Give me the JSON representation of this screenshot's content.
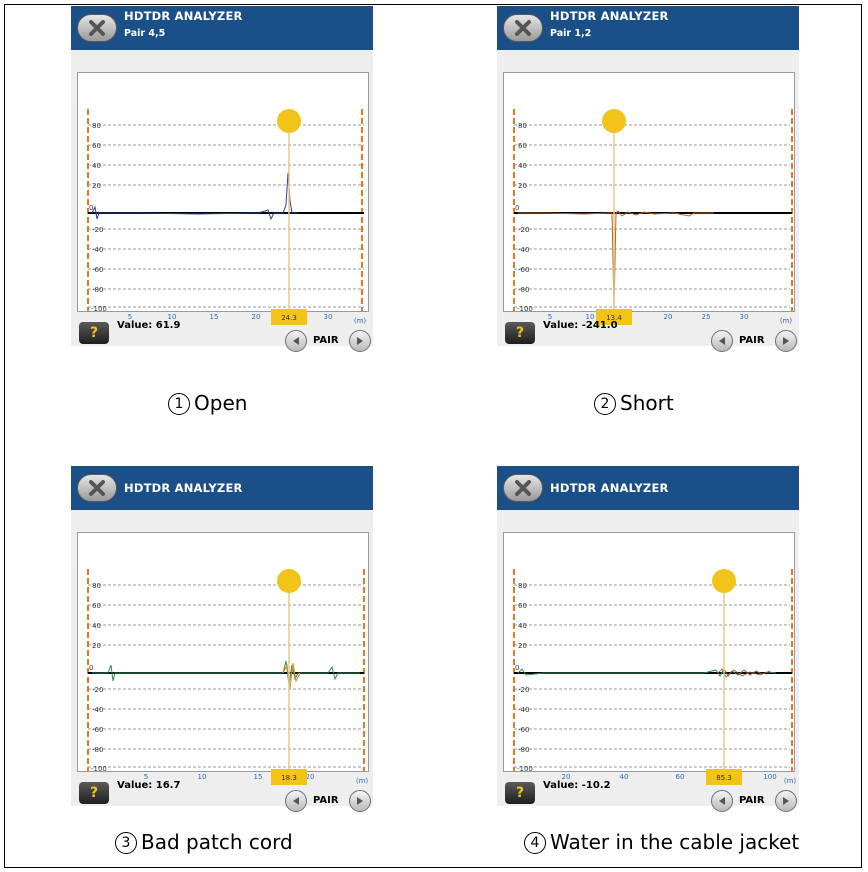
{
  "screens": [
    {
      "title": "HDTDR ANALYZER",
      "subtitle": "Pair 4,5",
      "value_text": "Value: 61.9",
      "cursor_label": "24.3",
      "pair_label": "PAIR",
      "help_label": "?",
      "caption_num": "1",
      "caption": "Open",
      "y_ticks": [
        "80",
        "60",
        "40",
        "20",
        "0",
        "-20",
        "-40",
        "-60",
        "-80",
        "-100"
      ],
      "x_ticks": [
        "5",
        "10",
        "15",
        "20",
        "25",
        "30",
        "(m)"
      ]
    },
    {
      "title": "HDTDR ANALYZER",
      "subtitle": "Pair 1,2",
      "value_text": "Value: -241.0",
      "cursor_label": "13.4",
      "pair_label": "PAIR",
      "help_label": "?",
      "caption_num": "2",
      "caption": "Short",
      "y_ticks": [
        "80",
        "60",
        "40",
        "20",
        "0",
        "-20",
        "-40",
        "-60",
        "-80",
        "-100"
      ],
      "x_ticks": [
        "5",
        "10",
        "15",
        "20",
        "25",
        "30",
        "(m)"
      ]
    },
    {
      "title": "HDTDR ANALYZER",
      "subtitle": "",
      "value_text": "Value: 16.7",
      "cursor_label": "18.3",
      "pair_label": "PAIR",
      "help_label": "?",
      "caption_num": "3",
      "caption": "Bad patch cord",
      "y_ticks": [
        "80",
        "60",
        "40",
        "20",
        "0",
        "-20",
        "-40",
        "-60",
        "-80",
        "-100"
      ],
      "x_ticks": [
        "5",
        "10",
        "15",
        "20",
        "(m)"
      ]
    },
    {
      "title": "HDTDR ANALYZER",
      "subtitle": "",
      "value_text": "Value: -10.2",
      "cursor_label": "85.3",
      "pair_label": "PAIR",
      "help_label": "?",
      "caption_num": "4",
      "caption": "Water in the cable jacket",
      "y_ticks": [
        "80",
        "60",
        "40",
        "20",
        "0",
        "-20",
        "-40",
        "-60",
        "-80",
        "-100"
      ],
      "x_ticks": [
        "20",
        "40",
        "60",
        "100",
        "(m)"
      ]
    }
  ],
  "colors": {
    "header": "#1b4f87",
    "cursor_marker": "#f2c318",
    "cursor_line": "#e8c98a",
    "boundary_line": "#e87722",
    "axis_tick_text": "#2e6db4"
  }
}
